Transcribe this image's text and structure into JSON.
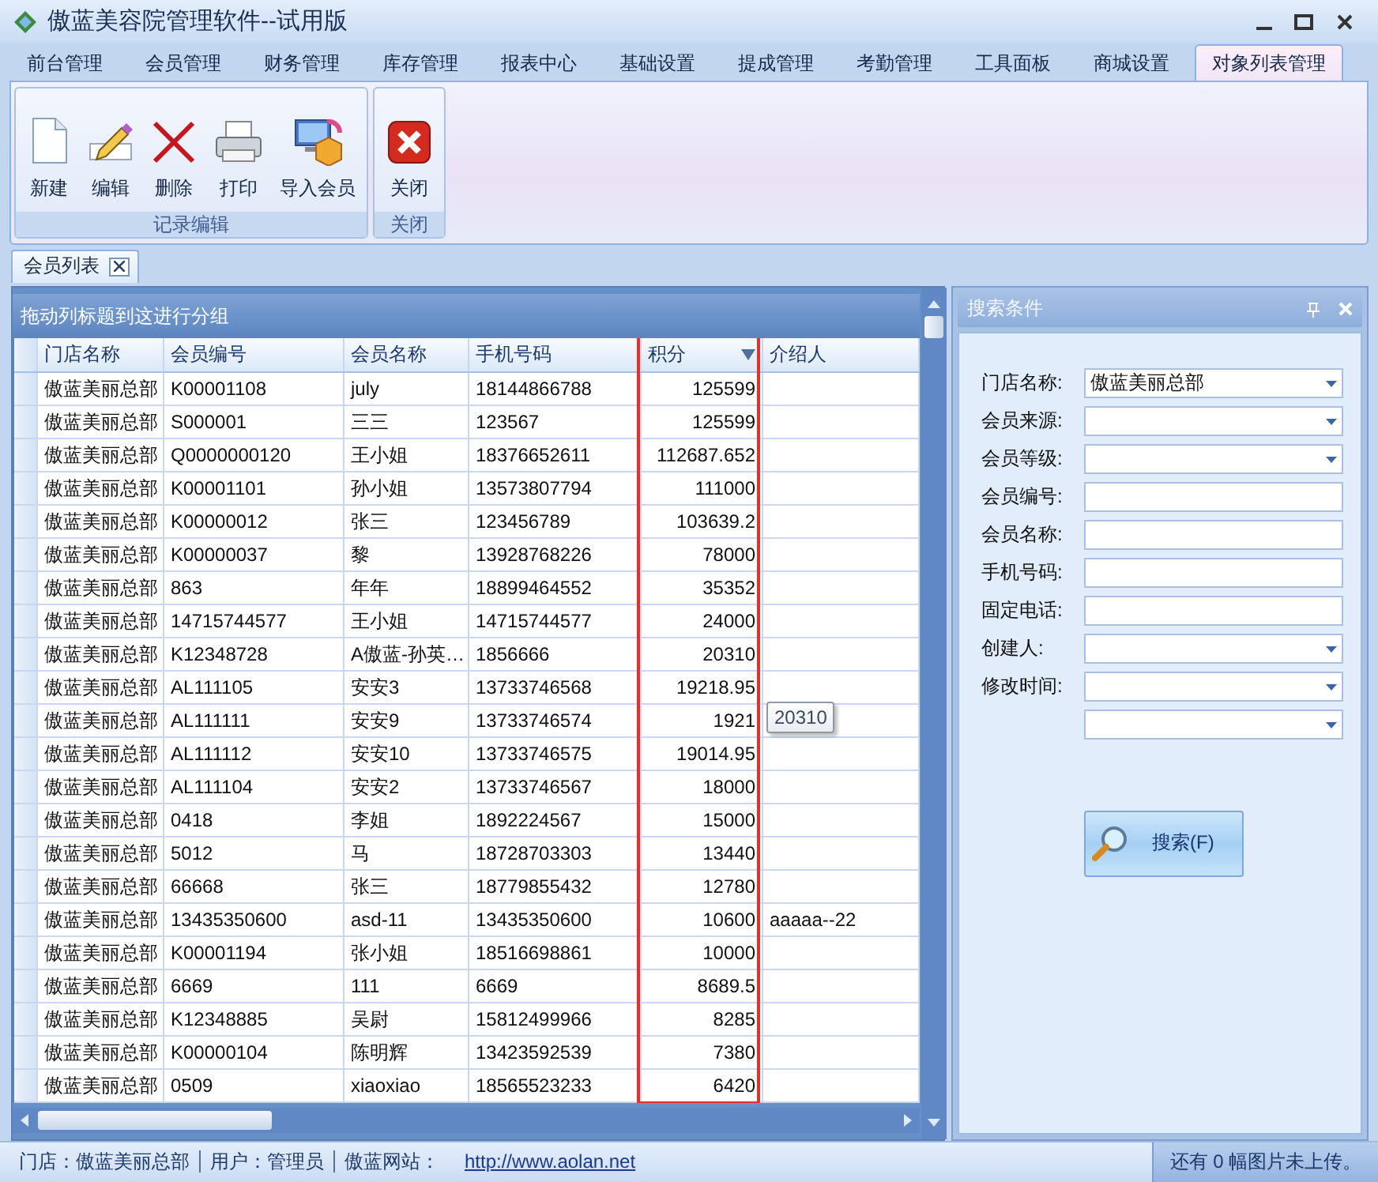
{
  "window": {
    "title": "傲蓝美容院管理软件--试用版"
  },
  "tabs": [
    {
      "label": "前台管理",
      "selected": false
    },
    {
      "label": "会员管理",
      "selected": false
    },
    {
      "label": "财务管理",
      "selected": false
    },
    {
      "label": "库存管理",
      "selected": false
    },
    {
      "label": "报表中心",
      "selected": false
    },
    {
      "label": "基础设置",
      "selected": false
    },
    {
      "label": "提成管理",
      "selected": false
    },
    {
      "label": "考勤管理",
      "selected": false
    },
    {
      "label": "工具面板",
      "selected": false
    },
    {
      "label": "商城设置",
      "selected": false
    },
    {
      "label": "对象列表管理",
      "selected": true
    }
  ],
  "ribbon_groups": [
    {
      "title": "记录编辑",
      "buttons": [
        {
          "label": "新建",
          "kind": "new"
        },
        {
          "label": "编辑",
          "kind": "edit"
        },
        {
          "label": "删除",
          "kind": "delete"
        },
        {
          "label": "打印",
          "kind": "print"
        },
        {
          "label": "导入会员",
          "kind": "import"
        }
      ]
    },
    {
      "title": "关闭",
      "buttons": [
        {
          "label": "关闭",
          "kind": "close"
        }
      ]
    }
  ],
  "document_tab": {
    "label": "会员列表"
  },
  "grid": {
    "group_hint": "拖动列标题到这进行分组",
    "columns": [
      {
        "label": "门店名称",
        "sorted": false,
        "highlighted": false
      },
      {
        "label": "会员编号",
        "sorted": false,
        "highlighted": false
      },
      {
        "label": "会员名称",
        "sorted": false,
        "highlighted": false
      },
      {
        "label": "手机号码",
        "sorted": false,
        "highlighted": false
      },
      {
        "label": "积分",
        "sorted": true,
        "highlighted": true
      },
      {
        "label": "介绍人",
        "sorted": false,
        "highlighted": false
      }
    ],
    "rows": [
      {
        "cells": [
          "傲蓝美丽总部",
          "K00001108",
          "july",
          "18144866788",
          "125599",
          ""
        ]
      },
      {
        "cells": [
          "傲蓝美丽总部",
          "S000001",
          "三三",
          "123567",
          "125599",
          ""
        ]
      },
      {
        "cells": [
          "傲蓝美丽总部",
          "Q0000000120",
          "王小姐",
          "18376652611",
          "112687.652",
          ""
        ]
      },
      {
        "cells": [
          "傲蓝美丽总部",
          "K00001101",
          "孙小姐",
          "13573807794",
          "111000",
          ""
        ]
      },
      {
        "cells": [
          "傲蓝美丽总部",
          "K00000012",
          "张三",
          "123456789",
          "103639.2",
          ""
        ]
      },
      {
        "cells": [
          "傲蓝美丽总部",
          "K00000037",
          "黎",
          "13928768226",
          "78000",
          ""
        ]
      },
      {
        "cells": [
          "傲蓝美丽总部",
          "863",
          "年年",
          "18899464552",
          "35352",
          ""
        ]
      },
      {
        "cells": [
          "傲蓝美丽总部",
          "14715744577",
          "王小姐",
          "14715744577",
          "24000",
          ""
        ]
      },
      {
        "cells": [
          "傲蓝美丽总部",
          "K12348728",
          "A傲蓝-孙英…",
          "1856666",
          "20310",
          ""
        ]
      },
      {
        "cells": [
          "傲蓝美丽总部",
          "AL111105",
          "安安3",
          "13733746568",
          "19218.95",
          ""
        ]
      },
      {
        "cells": [
          "傲蓝美丽总部",
          "AL111111",
          "安安9",
          "13733746574",
          "1921",
          ""
        ]
      },
      {
        "cells": [
          "傲蓝美丽总部",
          "AL111112",
          "安安10",
          "13733746575",
          "19014.95",
          ""
        ]
      },
      {
        "cells": [
          "傲蓝美丽总部",
          "AL111104",
          "安安2",
          "13733746567",
          "18000",
          ""
        ]
      },
      {
        "cells": [
          "傲蓝美丽总部",
          "0418",
          "李姐",
          "1892224567",
          "15000",
          ""
        ]
      },
      {
        "cells": [
          "傲蓝美丽总部",
          "5012",
          "马",
          "18728703303",
          "13440",
          ""
        ]
      },
      {
        "cells": [
          "傲蓝美丽总部",
          "66668",
          "张三",
          "18779855432",
          "12780",
          ""
        ]
      },
      {
        "cells": [
          "傲蓝美丽总部",
          "13435350600",
          "asd-11",
          "13435350600",
          "10600",
          "aaaaa--22"
        ]
      },
      {
        "cells": [
          "傲蓝美丽总部",
          "K00001194",
          "张小姐",
          "18516698861",
          "10000",
          ""
        ]
      },
      {
        "cells": [
          "傲蓝美丽总部",
          "6669",
          "111",
          "6669",
          "8689.5",
          ""
        ]
      },
      {
        "cells": [
          "傲蓝美丽总部",
          "K12348885",
          "吴尉",
          "15812499966",
          "8285",
          ""
        ]
      },
      {
        "cells": [
          "傲蓝美丽总部",
          "K00000104",
          "陈明辉",
          "13423592539",
          "7380",
          ""
        ]
      },
      {
        "cells": [
          "傲蓝美丽总部",
          "0509",
          "xiaoxiao",
          "18565523233",
          "6420",
          ""
        ]
      }
    ],
    "tooltip": {
      "text": "20310"
    }
  },
  "search_panel": {
    "title": "搜索条件",
    "fields": [
      {
        "label": "门店名称:",
        "kind": "dropdown",
        "value": "傲蓝美丽总部"
      },
      {
        "label": "会员来源:",
        "kind": "dropdown"
      },
      {
        "label": "会员等级:",
        "kind": "dropdown"
      },
      {
        "label": "会员编号:",
        "kind": "text"
      },
      {
        "label": "会员名称:",
        "kind": "text"
      },
      {
        "label": "手机号码:",
        "kind": "text"
      },
      {
        "label": "固定电话:",
        "kind": "text"
      },
      {
        "label": "创建人:",
        "kind": "dropdown"
      },
      {
        "label": "修改时间:",
        "kind": "dropdown"
      },
      {
        "kind": "dropdown"
      }
    ],
    "search_button": "搜索(F)"
  },
  "status_bar": {
    "items": [
      "门店：傲蓝美丽总部",
      "用户：管理员",
      "傲蓝网站："
    ],
    "link": "http://www.aolan.net",
    "upload_status": "还有 0 幅图片未上传。"
  }
}
